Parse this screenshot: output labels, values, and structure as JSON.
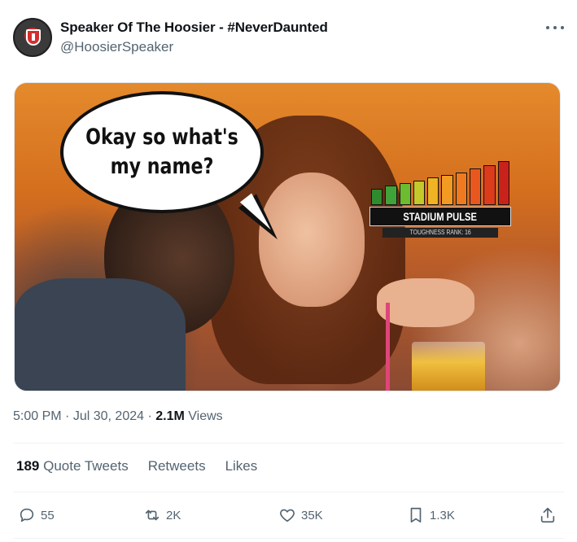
{
  "author": {
    "display_name": "Speaker Of The Hoosier - #NeverDaunted",
    "handle": "@HoosierSpeaker"
  },
  "media": {
    "speech_bubble": "Okay so what's my name?",
    "overlay": {
      "title": "STADIUM PULSE",
      "rank_text": "TOUGHNESS RANK: 16",
      "bar_colors": [
        "#2e8b2e",
        "#3fa33a",
        "#6dbb2e",
        "#c5c82a",
        "#f0b323",
        "#f39a22",
        "#ef7a20",
        "#e8581e",
        "#dc3b1c",
        "#c9221a"
      ],
      "bar_levels": [
        0.36,
        0.42,
        0.48,
        0.54,
        0.6,
        0.66,
        0.72,
        0.8,
        0.88,
        0.96
      ]
    }
  },
  "meta": {
    "time": "5:00 PM",
    "separator": "·",
    "date": "Jul 30, 2024",
    "views_count": "2.1M",
    "views_label": "Views"
  },
  "stats": {
    "quote_count": "189",
    "quote_label": "Quote Tweets",
    "retweets_label": "Retweets",
    "likes_label": "Likes"
  },
  "actions": {
    "replies": "55",
    "retweets": "2K",
    "likes": "35K",
    "bookmarks": "1.3K"
  }
}
